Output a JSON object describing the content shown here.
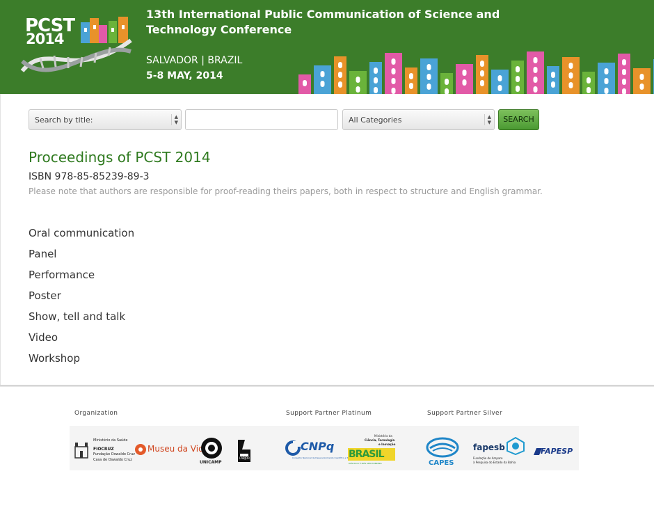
{
  "header": {
    "logo": {
      "brand": "PCST",
      "year": "2014"
    },
    "title": "13th International Public Communication of Science and Technology Conference",
    "location": "SALVADOR | BRAZIL",
    "date": "5-8 MAY, 2014",
    "colors": {
      "background": "#3c7d2a",
      "houses": [
        "#4aa3d6",
        "#e8922a",
        "#e25aa7",
        "#6ab33a"
      ]
    }
  },
  "search": {
    "field_select": {
      "selected": "Search by title:"
    },
    "query_input": {
      "value": "",
      "placeholder": ""
    },
    "category_select": {
      "selected": "All Categories"
    },
    "button_label": "SEARCH"
  },
  "main": {
    "title": "Proceedings of PCST 2014",
    "isbn": "ISBN 978-85-85239-89-3",
    "note": "Please note that authors are responsible for proof-reading theirs papers, both in respect to structure and English grammar.",
    "categories": [
      "Oral communication",
      "Panel",
      "Performance",
      "Poster",
      "Show, tell and talk",
      "Video",
      "Workshop"
    ]
  },
  "footer": {
    "labels": {
      "organization": "Organization",
      "platinum": "Support Partner   Platinum",
      "silver": "Support Partner Silver"
    },
    "logos": {
      "fiocruz": {
        "top": "Ministério da Saúde",
        "name": "FIOCRUZ",
        "sub1": "Fundação Oswaldo Cruz",
        "sub2": "Casa de Oswaldo Cruz"
      },
      "museu": "Museu da Vida",
      "unicamp": "UNICAMP",
      "labjor": "LABJOR",
      "cnpq": {
        "name": "CNPq",
        "sub": "Conselho Nacional de Desenvolvimento Científico e Tecnológico"
      },
      "brasil": {
        "top1": "Ministério da",
        "top2": "Ciência, Tecnologia",
        "top3": "e Inovação",
        "name": "BRASIL",
        "sub": "PAÍS RICO É PAÍS SEM POBREZA"
      },
      "capes": "CAPES",
      "fapesb": {
        "name": "fapesb",
        "sub1": "Fundação de Amparo",
        "sub2": "à Pesquisa do Estado da Bahia"
      },
      "fapesp": "FAPESP"
    }
  }
}
